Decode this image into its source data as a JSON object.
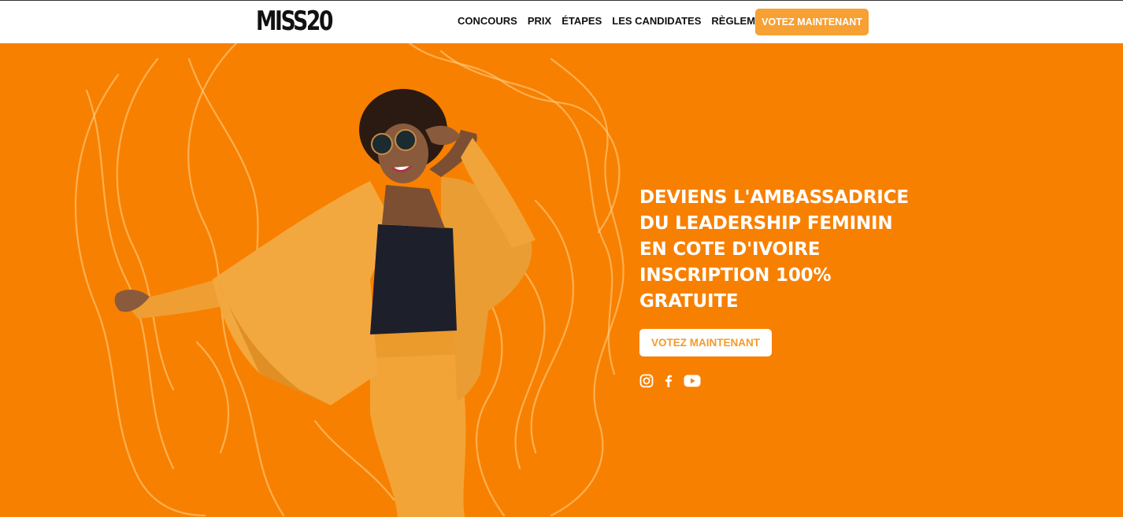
{
  "nav": {
    "logo_text": "MISS20",
    "links": [
      "CONCOURS",
      "PRIX",
      "ÉTAPES",
      "LES CANDIDATES",
      "RÈGLEMENT"
    ],
    "cta_label": "VOTEZ MAINTENANT"
  },
  "hero": {
    "headline_lines": [
      "DEVIENS L'AMBASSADRICE",
      "DU LEADERSHIP FEMININ",
      "EN COTE D'IVOIRE",
      "INSCRIPTION 100%",
      "GRATUITE"
    ],
    "cta_label": "VOTEZ MAINTENANT",
    "socials": [
      "instagram-icon",
      "facebook-icon",
      "youtube-icon"
    ]
  },
  "colors": {
    "hero_background": "#f88000",
    "accent": "#f7a033",
    "suit": "#f3a43a",
    "text_dark": "#111111",
    "white": "#ffffff"
  }
}
